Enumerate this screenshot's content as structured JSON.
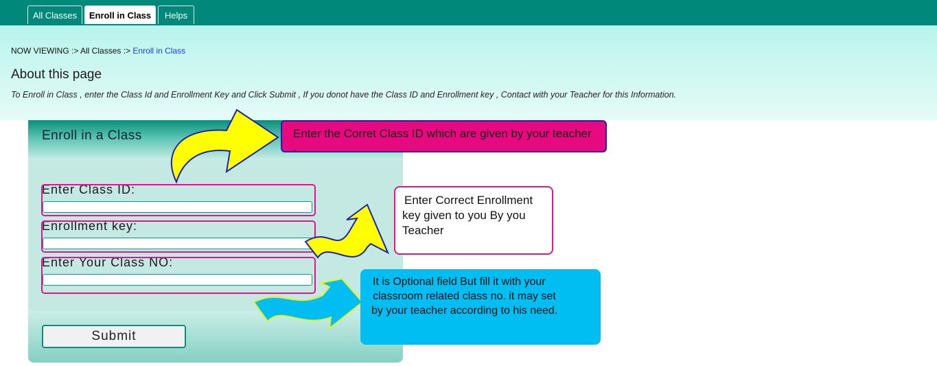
{
  "nav": {
    "tabs": [
      {
        "label": "All Classes"
      },
      {
        "label": "Enroll in Class"
      },
      {
        "label": "Helps"
      }
    ]
  },
  "breadcrumb": {
    "prefix": "NOW VIEWING :>",
    "parent": "All Classes :>",
    "current": "Enroll in Class"
  },
  "about": {
    "title": "About this page",
    "text": "To Enroll in Class , enter the Class Id and Enrollment Key and Click Submit , If you donot have the Class ID and Enrollment key , Contact with your Teacher for this Information."
  },
  "form": {
    "title": "Enroll in a Class",
    "class_id_label": "Enter Class ID:",
    "enrollment_key_label": "Enrollment key:",
    "class_no_label": "Enter Your Class NO:",
    "class_id_value": "",
    "enrollment_key_value": "",
    "class_no_value": "",
    "submit_label": "Submit"
  },
  "callouts": {
    "class_id": "Enter the Corret Class ID which are given by your teacher .",
    "enrollment_key": [
      "Enter Correct Enrollment",
      "key given to you By you",
      "Teacher"
    ],
    "class_no": [
      "It is Optional field But fill it with your",
      "classroom related class no. it may set",
      "by your teacher according to his need."
    ]
  },
  "colors": {
    "nav_bg": "#00897b",
    "callout_pink": "#e8087f",
    "callout_blue": "#00bdf2",
    "arrow_yellow": "#ffff00",
    "arrow_outline": "#1d1fb5"
  }
}
